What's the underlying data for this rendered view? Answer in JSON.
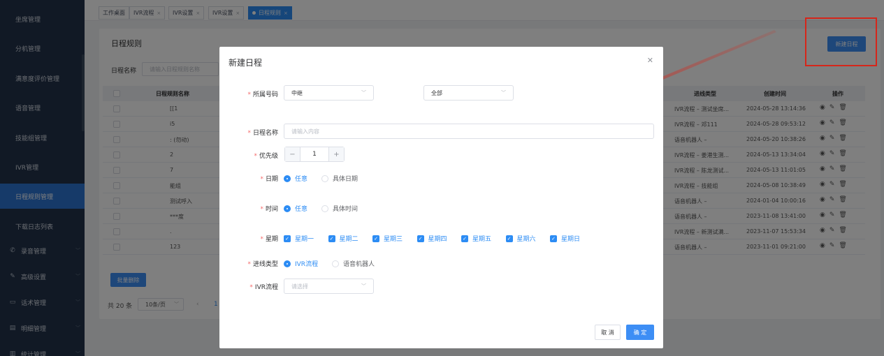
{
  "sidebar": {
    "items": [
      {
        "label": "坐席管理",
        "icon": "",
        "chev": ""
      },
      {
        "label": "分机管理",
        "icon": "",
        "chev": ""
      },
      {
        "label": "满意度评价管理",
        "icon": "",
        "chev": ""
      },
      {
        "label": "语音管理",
        "icon": "",
        "chev": ""
      },
      {
        "label": "技能组管理",
        "icon": "",
        "chev": ""
      },
      {
        "label": "IVR管理",
        "icon": "",
        "chev": ""
      },
      {
        "label": "日程规则管理",
        "icon": "",
        "chev": "",
        "active": true
      },
      {
        "label": "下载日志列表",
        "icon": "",
        "chev": ""
      },
      {
        "label": "录音管理",
        "icon": "phone-icon",
        "chev": "﹀"
      },
      {
        "label": "高级设置",
        "icon": "pen-icon",
        "chev": "﹀"
      },
      {
        "label": "话术管理",
        "icon": "chat-icon",
        "chev": "﹀"
      },
      {
        "label": "明细管理",
        "icon": "doc-icon",
        "chev": "﹀"
      },
      {
        "label": "统计管理",
        "icon": "chart-icon",
        "chev": "﹀"
      }
    ]
  },
  "tabs": [
    {
      "label": "工作桌面",
      "closable": false
    },
    {
      "label": "IVR流程",
      "closable": true
    },
    {
      "label": "IVR设置",
      "closable": true
    },
    {
      "label": "IVR设置",
      "closable": true
    },
    {
      "label": "日程规则",
      "closable": true,
      "active": true
    }
  ],
  "page": {
    "title": "日程规则",
    "add_button": "新建日程",
    "filter_label": "日程名称",
    "filter_placeholder": "请输入日程规则名称",
    "columns": {
      "name": "日程规则名称",
      "line_type": "进线类型",
      "created": "创建时间",
      "ops": "操作"
    },
    "rows": [
      {
        "name": "[[1",
        "line_type": "IVR流程 – 测试坐席...",
        "created": "2024-05-28 13:14:36"
      },
      {
        "name": "i5",
        "line_type": "IVR流程 – 邓111",
        "created": "2024-05-28 09:53:12"
      },
      {
        "name": ": (勿动)",
        "line_type": "语音机器人 –",
        "created": "2024-05-20 10:38:26"
      },
      {
        "name": "2",
        "line_type": "IVR流程 – 姜港生测...",
        "created": "2024-05-13 13:34:04"
      },
      {
        "name": "7",
        "line_type": "IVR流程 – 陈龙测试...",
        "created": "2024-05-13 11:01:05"
      },
      {
        "name": "能组",
        "line_type": "IVR流程 – 技能组",
        "created": "2024-05-08 10:38:49"
      },
      {
        "name": "测试呼入",
        "line_type": "语音机器人 –",
        "created": "2024-01-04 10:00:16"
      },
      {
        "name": "***度",
        "line_type": "语音机器人 –",
        "created": "2023-11-08 13:41:00"
      },
      {
        "name": ".",
        "line_type": "IVR流程 – 新测试满...",
        "created": "2023-11-07 15:53:34"
      },
      {
        "name": "123",
        "line_type": "语音机器人 –",
        "created": "2023-11-01 09:21:00"
      }
    ],
    "batch_delete": "批量删除",
    "total": "共 20 条",
    "page_size": "10条/页",
    "current_page": "1"
  },
  "dialog": {
    "title": "新建日程",
    "fields": {
      "number_label": "所属号码",
      "number_value": "中继",
      "number_value2": "全部",
      "name_label": "日程名称",
      "name_placeholder": "请输入内容",
      "priority_label": "优先级",
      "priority_value": "1",
      "date_label": "日期",
      "date_opt1": "任意",
      "date_opt2": "具体日期",
      "time_label": "时间",
      "time_opt1": "任意",
      "time_opt2": "具体时间",
      "week_label": "星期",
      "weekdays": [
        "星期一",
        "星期二",
        "星期三",
        "星期四",
        "星期五",
        "星期六",
        "星期日"
      ],
      "line_label": "进线类型",
      "line_opt1": "IVR流程",
      "line_opt2": "语音机器人",
      "ivr_label": "IVR流程",
      "ivr_placeholder": "请选择"
    },
    "cancel": "取 消",
    "ok": "确 定"
  },
  "colors": {
    "primary": "#3d8ef5",
    "sidebar": "#22324a",
    "annotation": "#d6261a"
  }
}
